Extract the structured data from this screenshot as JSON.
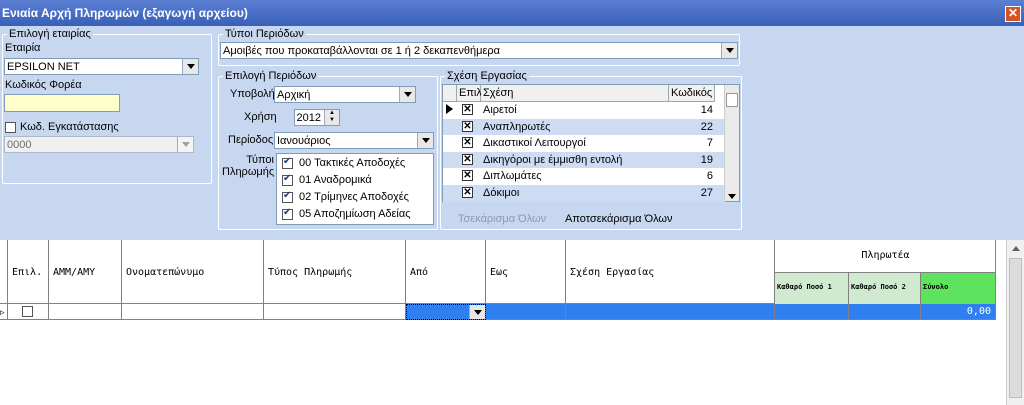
{
  "window": {
    "title": "Ενιαία Αρχή Πληρωμών (εξαγωγή αρχείου)",
    "close": "✕"
  },
  "company": {
    "group_title": "Επιλογή εταιρίας",
    "company_label": "Εταιρία",
    "company_value": "EPSILON NET",
    "carrier_label": "Κωδικός Φορέα",
    "carrier_value": "",
    "install_label": "Κωδ. Εγκατάστασης",
    "install_value": "0000"
  },
  "period_types": {
    "group_title": "Τύποι Περιόδων",
    "value": "Αμοιβές που προκαταβάλλονται σε 1 ή 2 δεκαπενθήμερα"
  },
  "period_select": {
    "group_title": "Επιλογή Περιόδων",
    "submission_label": "Υποβολή",
    "submission_value": "Αρχική",
    "year_label": "Χρήση",
    "year_value": "2012",
    "period_label": "Περίοδος",
    "period_value": "Ιανουάριος",
    "payment_types_label": "Τύποι Πληρωμής",
    "payment_types": [
      {
        "label": "00 Τακτικές Αποδοχές",
        "checked": true
      },
      {
        "label": "01 Αναδρομικά",
        "checked": true
      },
      {
        "label": "02 Τρίμηνες Αποδοχές",
        "checked": true
      },
      {
        "label": "05 Αποζημίωση Αδείας",
        "checked": true
      }
    ]
  },
  "relation": {
    "group_title": "Σχέση Εργασίας",
    "headers": {
      "select": "Επιλ.",
      "relation": "Σχέση",
      "code": "Κωδικός"
    },
    "rows": [
      {
        "name": "Αιρετοί",
        "code": "14",
        "checked": true
      },
      {
        "name": "Αναπληρωτές",
        "code": "22",
        "checked": true
      },
      {
        "name": "Δικαστικοί Λειτουργοί",
        "code": "7",
        "checked": true
      },
      {
        "name": "Δικηγόροι με έμμισθη εντολή",
        "code": "19",
        "checked": true
      },
      {
        "name": "Διπλωμάτες",
        "code": "6",
        "checked": true
      },
      {
        "name": "Δόκιμοι",
        "code": "27",
        "checked": true
      }
    ],
    "check_all": "Τσεκάρισμα Όλων",
    "uncheck_all": "Αποτσεκάρισμα Όλων"
  },
  "grid": {
    "headers": {
      "select": "Επιλ.",
      "amm": "ΑΜΜ/ΑΜΥ",
      "name": "Ονοματεπώνυμο",
      "pay_type": "Τύπος Πληρωμής",
      "from": "Από",
      "to": "Εως",
      "relation": "Σχέση Εργασίας",
      "payable": "Πληρωτέα",
      "net1": "Καθαρό Ποσό 1",
      "net2": "Καθαρό Ποσό 2",
      "total": "Σύνολο"
    },
    "row": {
      "total": "0,00"
    }
  },
  "colors": {
    "panel": "#c7d7ef",
    "title": "#3a5fb8",
    "selected": "#2f7ff0",
    "total_header": "#5ee35e"
  }
}
